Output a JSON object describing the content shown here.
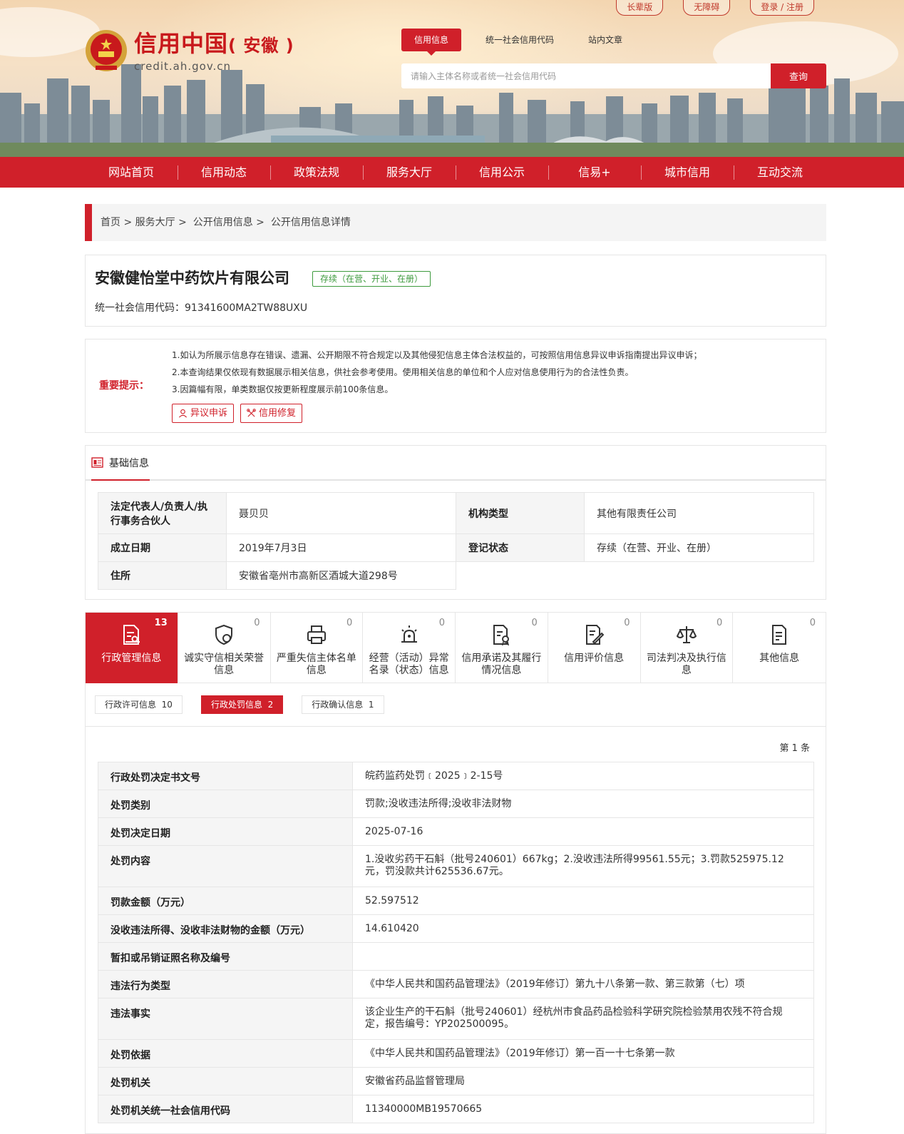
{
  "header": {
    "top_links": [
      "长辈版",
      "无障碍",
      "登录 / 注册"
    ],
    "logo_title": "信用中国",
    "logo_province": "( 安徽 )",
    "logo_url": "credit.ah.gov.cn",
    "search_tabs": [
      "信用信息",
      "统一社会信用代码",
      "站内文章"
    ],
    "search_placeholder": "请输入主体名称或者统一社会信用代码",
    "search_button": "查询"
  },
  "nav": [
    "网站首页",
    "信用动态",
    "政策法规",
    "服务大厅",
    "信用公示",
    "信易+",
    "城市信用",
    "互动交流"
  ],
  "breadcrumb": [
    "首页",
    "服务大厅",
    "公开信用信息",
    "公开信用信息详情"
  ],
  "company": {
    "name": "安徽健怡堂中药饮片有限公司",
    "status": "存续（在营、开业、在册）",
    "credit_code_label": "统一社会信用代码：",
    "credit_code": "91341600MA2TW88UXU"
  },
  "notice": {
    "label": "重要提示：",
    "lines": [
      "1.如认为所展示信息存在错误、遗漏、公开期限不符合规定以及其他侵犯信息主体合法权益的，可按照信用信息异议申诉指南提出异议申诉；",
      "2.本查询结果仅依现有数据展示相关信息，供社会参考使用。使用相关信息的单位和个人应对信息使用行为的合法性负责。",
      "3.因篇幅有限，单类数据仅按更新程度展示前100条信息。"
    ],
    "buttons": [
      "异议申诉",
      "信用修复"
    ]
  },
  "basic_info": {
    "title": "基础信息",
    "rows": [
      {
        "k1": "法定代表人/负责人/执行事务合伙人",
        "v1": "聂贝贝",
        "k2": "机构类型",
        "v2": "其他有限责任公司"
      },
      {
        "k1": "成立日期",
        "v1": "2019年7月3日",
        "k2": "登记状态",
        "v2": "存续（在营、开业、在册）"
      },
      {
        "k1": "住所",
        "v1": "安徽省亳州市高新区酒城大道298号",
        "k2": "",
        "v2": ""
      }
    ]
  },
  "categories": [
    {
      "label": "行政管理信息",
      "count": "13",
      "icon": "admin-doc-icon"
    },
    {
      "label": "诚实守信相关荣誉信息",
      "count": "0",
      "icon": "honor-shield-icon"
    },
    {
      "label": "严重失信主体名单信息",
      "count": "0",
      "icon": "blacklist-printer-icon"
    },
    {
      "label": "经营（活动）异常名录（状态）信息",
      "count": "0",
      "icon": "alarm-light-icon"
    },
    {
      "label": "信用承诺及其履行情况信息",
      "count": "0",
      "icon": "promise-doc-icon"
    },
    {
      "label": "信用评价信息",
      "count": "0",
      "icon": "evaluation-pen-icon"
    },
    {
      "label": "司法判决及执行信息",
      "count": "0",
      "icon": "justice-scale-icon"
    },
    {
      "label": "其他信息",
      "count": "0",
      "icon": "other-doc-icon"
    }
  ],
  "sub_tabs": [
    {
      "label": "行政许可信息",
      "count": "10"
    },
    {
      "label": "行政处罚信息",
      "count": "2"
    },
    {
      "label": "行政确认信息",
      "count": "1"
    }
  ],
  "record": {
    "page_label": "第 1 条",
    "rows": [
      {
        "k": "行政处罚决定书文号",
        "v": "皖药监药处罚﹝2025﹞2-15号"
      },
      {
        "k": "处罚类别",
        "v": "罚款;没收违法所得;没收非法财物"
      },
      {
        "k": "处罚决定日期",
        "v": "2025-07-16"
      },
      {
        "k": "处罚内容",
        "v": "1.没收劣药干石斛（批号240601）667kg；2.没收违法所得99561.55元；3.罚款525975.12元，罚没款共计625536.67元。"
      },
      {
        "k": "罚款金额（万元）",
        "v": "52.597512"
      },
      {
        "k": "没收违法所得、没收非法财物的金额（万元）",
        "v": "14.610420"
      },
      {
        "k": "暂扣或吊销证照名称及编号",
        "v": ""
      },
      {
        "k": "违法行为类型",
        "v": "《中华人民共和国药品管理法》（2019年修订）第九十八条第一款、第三款第（七）项"
      },
      {
        "k": "违法事实",
        "v": "该企业生产的干石斛（批号240601）经杭州市食品药品检验科学研究院检验禁用农残不符合规定，报告编号：YP202500095。"
      },
      {
        "k": "处罚依据",
        "v": "《中华人民共和国药品管理法》（2019年修订）第一百一十七条第一款"
      },
      {
        "k": "处罚机关",
        "v": "安徽省药品监督管理局"
      },
      {
        "k": "处罚机关统一社会信用代码",
        "v": "11340000MB19570665"
      }
    ]
  }
}
